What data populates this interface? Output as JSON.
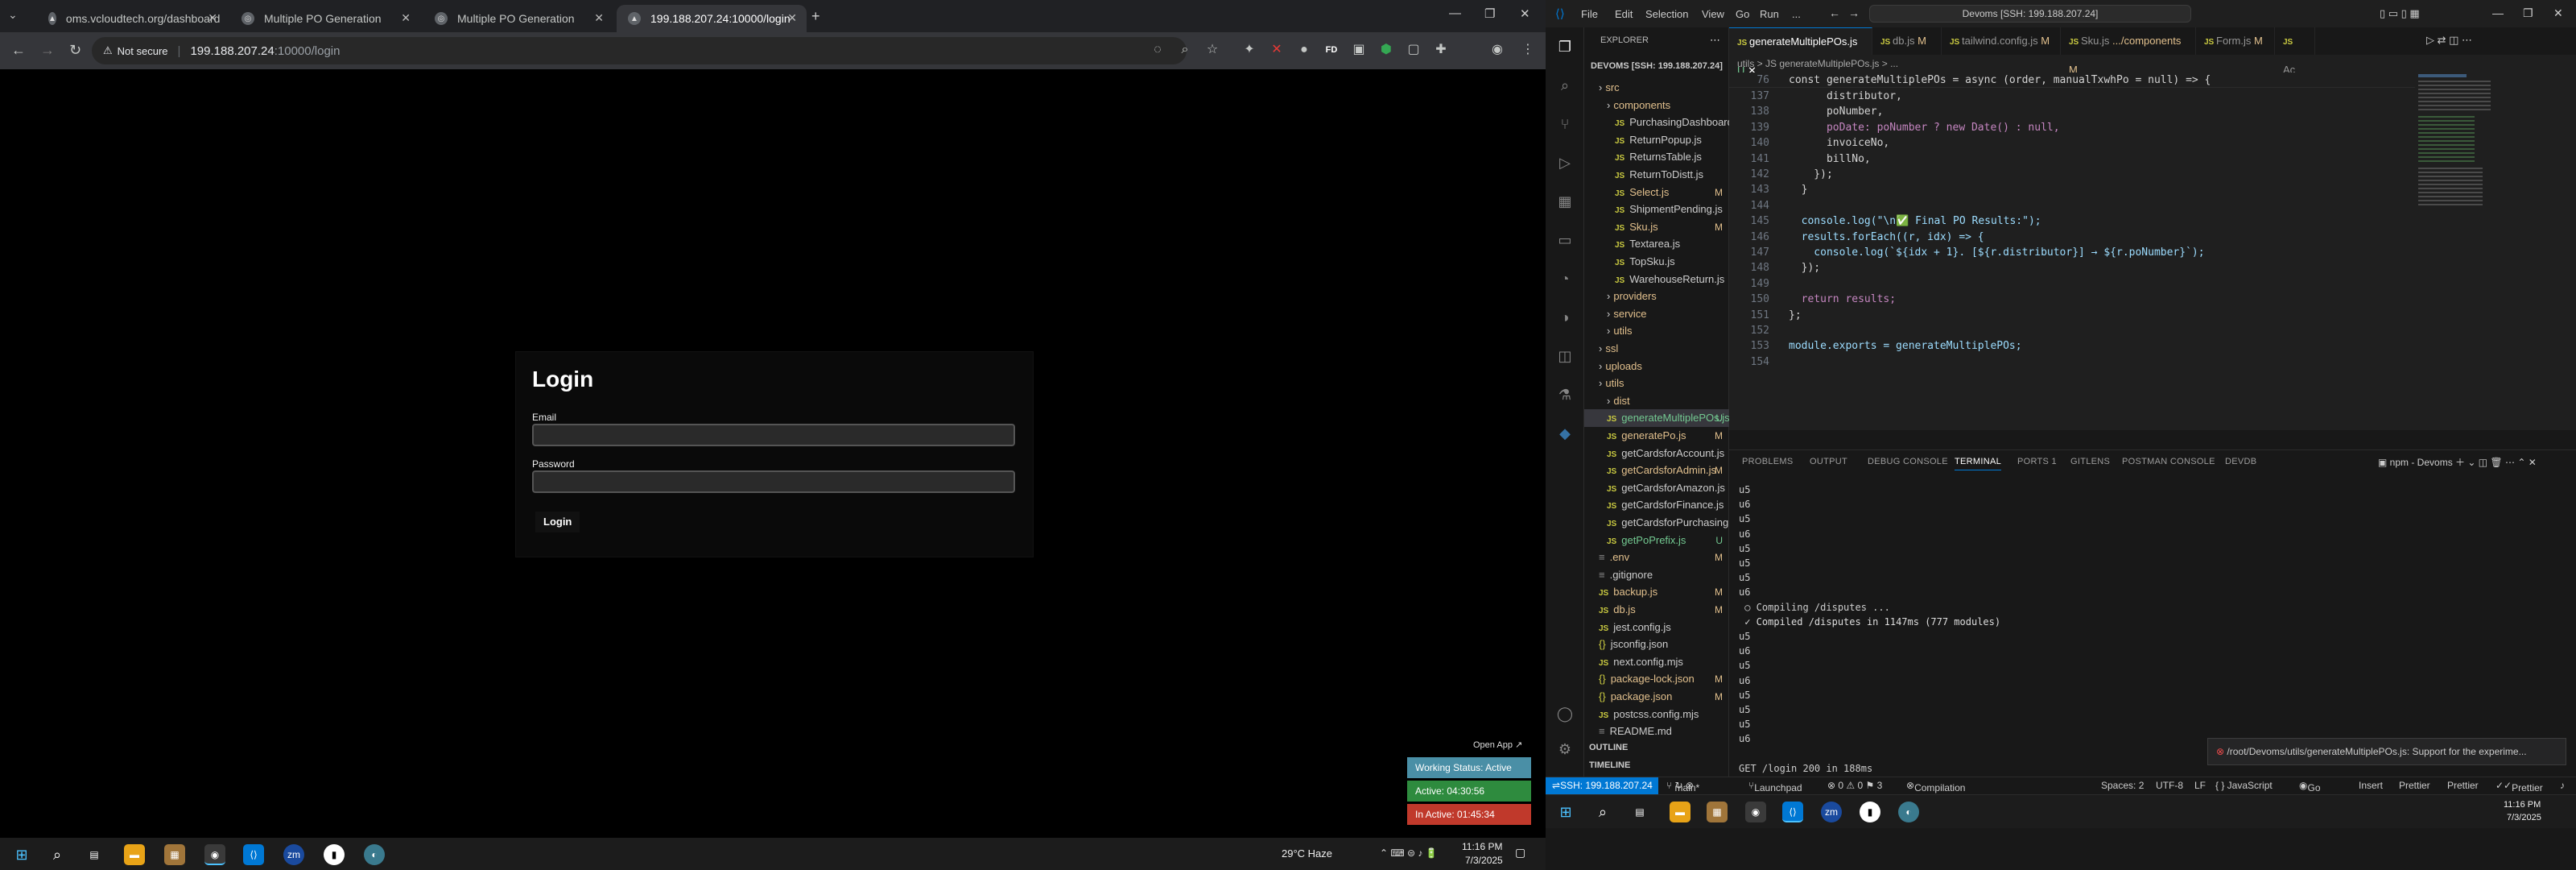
{
  "browser": {
    "tabs": [
      {
        "title": "oms.vcloudtech.org/dashboard",
        "icon": "globe-icon"
      },
      {
        "title": "Multiple PO Generation",
        "icon": "globe-icon"
      },
      {
        "title": "Multiple PO Generation",
        "icon": "globe-icon"
      },
      {
        "title": "199.188.207.24:10000/login",
        "icon": "globe-icon"
      }
    ],
    "new_tab": "+",
    "security_label": "Not secure",
    "url_host": "199.188.207.24",
    "url_path": ":10000/login"
  },
  "login": {
    "title": "Login",
    "email_label": "Email",
    "email_value": "",
    "password_label": "Password",
    "password_value": "",
    "submit_label": "Login"
  },
  "work_widget": {
    "open_app": "Open App ↗",
    "status": "Working Status: Active",
    "active": "Active: 04:30:56",
    "inactive": "In Active: 01:45:34",
    "colors": {
      "status": "#4a8fa6",
      "active": "#2e8b3e",
      "inactive": "#c0392b"
    }
  },
  "taskbar_left": {
    "weather": "29°C  Haze",
    "time": "11:16 PM",
    "date": "7/3/2025"
  },
  "vscode": {
    "menu": [
      "File",
      "Edit",
      "Selection",
      "View",
      "Go",
      "Run",
      "..."
    ],
    "command_center": "Devoms [SSH: 199.188.207.24]",
    "explorer_title": "EXPLORER",
    "workspace": "DEVOMS [SSH: 199.188.207.24]",
    "tree": [
      {
        "label": "src",
        "type": "folder",
        "indent": 1,
        "badge": ""
      },
      {
        "label": "components",
        "type": "folder",
        "indent": 2,
        "badge": ""
      },
      {
        "label": "PurchasingDashboard.js",
        "type": "js",
        "indent": 3,
        "badge": ""
      },
      {
        "label": "ReturnPopup.js",
        "type": "js",
        "indent": 3,
        "badge": ""
      },
      {
        "label": "ReturnsTable.js",
        "type": "js",
        "indent": 3,
        "badge": ""
      },
      {
        "label": "ReturnToDistt.js",
        "type": "js",
        "indent": 3,
        "badge": ""
      },
      {
        "label": "Select.js",
        "type": "js",
        "indent": 3,
        "badge": "M"
      },
      {
        "label": "ShipmentPending.js",
        "type": "js",
        "indent": 3,
        "badge": ""
      },
      {
        "label": "Sku.js",
        "type": "js",
        "indent": 3,
        "badge": "M"
      },
      {
        "label": "Textarea.js",
        "type": "js",
        "indent": 3,
        "badge": ""
      },
      {
        "label": "TopSku.js",
        "type": "js",
        "indent": 3,
        "badge": ""
      },
      {
        "label": "WarehouseReturn.js",
        "type": "js",
        "indent": 3,
        "badge": ""
      },
      {
        "label": "providers",
        "type": "folder",
        "indent": 2,
        "badge": ""
      },
      {
        "label": "service",
        "type": "folder",
        "indent": 2,
        "badge": ""
      },
      {
        "label": "utils",
        "type": "folder",
        "indent": 2,
        "badge": ""
      },
      {
        "label": "ssl",
        "type": "folder",
        "indent": 1,
        "badge": ""
      },
      {
        "label": "uploads",
        "type": "folder",
        "indent": 1,
        "badge": ""
      },
      {
        "label": "utils",
        "type": "folder",
        "indent": 1,
        "badge": ""
      },
      {
        "label": "dist",
        "type": "folder",
        "indent": 2,
        "badge": ""
      },
      {
        "label": "generateMultiplePOs.js",
        "type": "js",
        "indent": 2,
        "badge": "U"
      },
      {
        "label": "generatePo.js",
        "type": "js",
        "indent": 2,
        "badge": "M"
      },
      {
        "label": "getCardsforAccount.js",
        "type": "js",
        "indent": 2,
        "badge": ""
      },
      {
        "label": "getCardsforAdmin.js",
        "type": "js",
        "indent": 2,
        "badge": "M"
      },
      {
        "label": "getCardsforAmazon.js",
        "type": "js",
        "indent": 2,
        "badge": ""
      },
      {
        "label": "getCardsforFinance.js",
        "type": "js",
        "indent": 2,
        "badge": ""
      },
      {
        "label": "getCardsforPurchasing.js",
        "type": "js",
        "indent": 2,
        "badge": ""
      },
      {
        "label": "getPoPrefix.js",
        "type": "js",
        "indent": 2,
        "badge": "U"
      },
      {
        "label": ".env",
        "type": "file",
        "indent": 1,
        "badge": "M"
      },
      {
        "label": ".gitignore",
        "type": "file",
        "indent": 1,
        "badge": ""
      },
      {
        "label": "backup.js",
        "type": "js",
        "indent": 1,
        "badge": "M"
      },
      {
        "label": "db.js",
        "type": "js",
        "indent": 1,
        "badge": "M"
      },
      {
        "label": "jest.config.js",
        "type": "js",
        "indent": 1,
        "badge": ""
      },
      {
        "label": "jsconfig.json",
        "type": "json",
        "indent": 1,
        "badge": ""
      },
      {
        "label": "next.config.mjs",
        "type": "js",
        "indent": 1,
        "badge": ""
      },
      {
        "label": "package-lock.json",
        "type": "json",
        "indent": 1,
        "badge": "M"
      },
      {
        "label": "package.json",
        "type": "json",
        "indent": 1,
        "badge": "M"
      },
      {
        "label": "postcss.config.mjs",
        "type": "js",
        "indent": 1,
        "badge": ""
      },
      {
        "label": "README.md",
        "type": "file",
        "indent": 1,
        "badge": ""
      }
    ],
    "outline": "OUTLINE",
    "timeline": "TIMELINE",
    "editor_tabs": [
      {
        "label": "generateMultiplePOs.js",
        "badge": "U"
      },
      {
        "label": "db.js",
        "badge": "M"
      },
      {
        "label": "tailwind.config.js",
        "badge": "M"
      },
      {
        "label": "Sku.js",
        "badge": ".../components M"
      },
      {
        "label": "Form.js",
        "badge": "M"
      },
      {
        "label": "Ac",
        "badge": ""
      }
    ],
    "breadcrumb": "utils > JS generateMultiplePOs.js > ...",
    "sticky": {
      "num": "76",
      "code": "const generateMultiplePOs = async (order, manualTxwhPo = null) => {"
    },
    "code_lines": [
      {
        "num": "137",
        "code": "      distributor,"
      },
      {
        "num": "138",
        "code": "      poNumber,"
      },
      {
        "num": "139",
        "code": "      poDate: poNumber ? new Date() : null,"
      },
      {
        "num": "140",
        "code": "      invoiceNo,"
      },
      {
        "num": "141",
        "code": "      billNo,"
      },
      {
        "num": "142",
        "code": "    });"
      },
      {
        "num": "143",
        "code": "  }"
      },
      {
        "num": "144",
        "code": ""
      },
      {
        "num": "145",
        "code": "  console.log(\"\\n✅ Final PO Results:\");"
      },
      {
        "num": "146",
        "code": "  results.forEach((r, idx) => {"
      },
      {
        "num": "147",
        "code": "    console.log(`${idx + 1}. [${r.distributor}] → ${r.poNumber}`);"
      },
      {
        "num": "148",
        "code": "  });"
      },
      {
        "num": "149",
        "code": ""
      },
      {
        "num": "150",
        "code": "  return results;"
      },
      {
        "num": "151",
        "code": "};"
      },
      {
        "num": "152",
        "code": ""
      },
      {
        "num": "153",
        "code": "module.exports = generateMultiplePOs;"
      },
      {
        "num": "154",
        "code": ""
      }
    ],
    "panel_tabs": [
      "PROBLEMS",
      "OUTPUT",
      "DEBUG CONSOLE",
      "TERMINAL",
      "PORTS 1",
      "GITLENS",
      "POSTMAN CONSOLE",
      "DEVDB"
    ],
    "terminal_name": "npm - Devoms",
    "terminal_lines": [
      "u5",
      "u6",
      "u5",
      "u6",
      "u5",
      "u5",
      "u5",
      "u6",
      " ○ Compiling /disputes ...",
      " ✓ Compiled /disputes in 1147ms (777 modules)",
      "u5",
      "u6",
      "u5",
      "u6",
      "u5",
      "u5",
      "u5",
      "u6",
      "",
      "GET /login 200 in 188ms"
    ],
    "notification": "/root/Devoms/utils/generateMultiplePOs.js: Support for the experime...",
    "status": {
      "remote": "SSH: 199.188.207.24",
      "branch": "main*",
      "launchpad": "Launchpad",
      "problems": "⊗ 0  ⚠ 0   ⚑ 3",
      "compile": "Compilation Failed!",
      "spaces": "Spaces: 2",
      "encoding": "UTF-8",
      "eol": "LF",
      "lang": "{ } JavaScript",
      "golive": "Go Live",
      "insert": "Insert",
      "prettier1": "Prettier",
      "prettier2": "Prettier",
      "prettier3": "Prettier"
    },
    "taskbar_time": "11:16 PM",
    "taskbar_date": "7/3/2025"
  }
}
